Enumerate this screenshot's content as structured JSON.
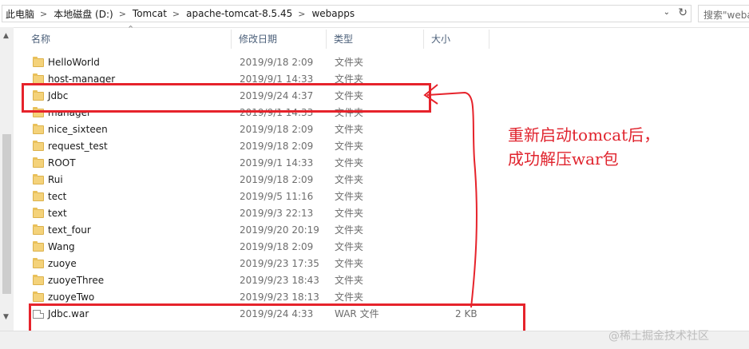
{
  "address": {
    "segments": [
      "此电脑",
      "本地磁盘 (D:)",
      "Tomcat",
      "apache-tomcat-8.5.45",
      "webapps"
    ],
    "separator": ">",
    "search_placeholder": "搜索\"webapps\""
  },
  "columns": {
    "name": "名称",
    "date": "修改日期",
    "type": "类型",
    "size": "大小"
  },
  "rows": [
    {
      "name": "HelloWorld",
      "date": "2019/9/18 2:09",
      "type": "文件夹",
      "size": "",
      "icon": "folder-icon"
    },
    {
      "name": "host-manager",
      "date": "2019/9/1 14:33",
      "type": "文件夹",
      "size": "",
      "icon": "folder-icon"
    },
    {
      "name": "Jdbc",
      "date": "2019/9/24 4:37",
      "type": "文件夹",
      "size": "",
      "icon": "folder-icon"
    },
    {
      "name": "manager",
      "date": "2019/9/1 14:33",
      "type": "文件夹",
      "size": "",
      "icon": "folder-icon"
    },
    {
      "name": "nice_sixteen",
      "date": "2019/9/18 2:09",
      "type": "文件夹",
      "size": "",
      "icon": "folder-icon"
    },
    {
      "name": "request_test",
      "date": "2019/9/18 2:09",
      "type": "文件夹",
      "size": "",
      "icon": "folder-icon"
    },
    {
      "name": "ROOT",
      "date": "2019/9/1 14:33",
      "type": "文件夹",
      "size": "",
      "icon": "folder-icon"
    },
    {
      "name": "Rui",
      "date": "2019/9/18 2:09",
      "type": "文件夹",
      "size": "",
      "icon": "folder-icon"
    },
    {
      "name": "tect",
      "date": "2019/9/5 11:16",
      "type": "文件夹",
      "size": "",
      "icon": "folder-icon"
    },
    {
      "name": "text",
      "date": "2019/9/3 22:13",
      "type": "文件夹",
      "size": "",
      "icon": "folder-icon"
    },
    {
      "name": "text_four",
      "date": "2019/9/20 20:19",
      "type": "文件夹",
      "size": "",
      "icon": "folder-icon"
    },
    {
      "name": "Wang",
      "date": "2019/9/18 2:09",
      "type": "文件夹",
      "size": "",
      "icon": "folder-icon"
    },
    {
      "name": "zuoye",
      "date": "2019/9/23 17:35",
      "type": "文件夹",
      "size": "",
      "icon": "folder-icon"
    },
    {
      "name": "zuoyeThree",
      "date": "2019/9/23 18:43",
      "type": "文件夹",
      "size": "",
      "icon": "folder-icon"
    },
    {
      "name": "zuoyeTwo",
      "date": "2019/9/23 18:13",
      "type": "文件夹",
      "size": "",
      "icon": "folder-icon"
    },
    {
      "name": "Jdbc.war",
      "date": "2019/9/24 4:33",
      "type": "WAR 文件",
      "size": "2 KB",
      "icon": "file-icon"
    }
  ],
  "annotation": {
    "line1": "重新启动tomcat后，",
    "line2": "成功解压war包",
    "color": "#e6232b"
  },
  "watermark": "@稀土掘金技术社区",
  "colors": {
    "folder": "#f4d27a",
    "header_text": "#4c607a",
    "annotation_red": "#e6232b"
  }
}
